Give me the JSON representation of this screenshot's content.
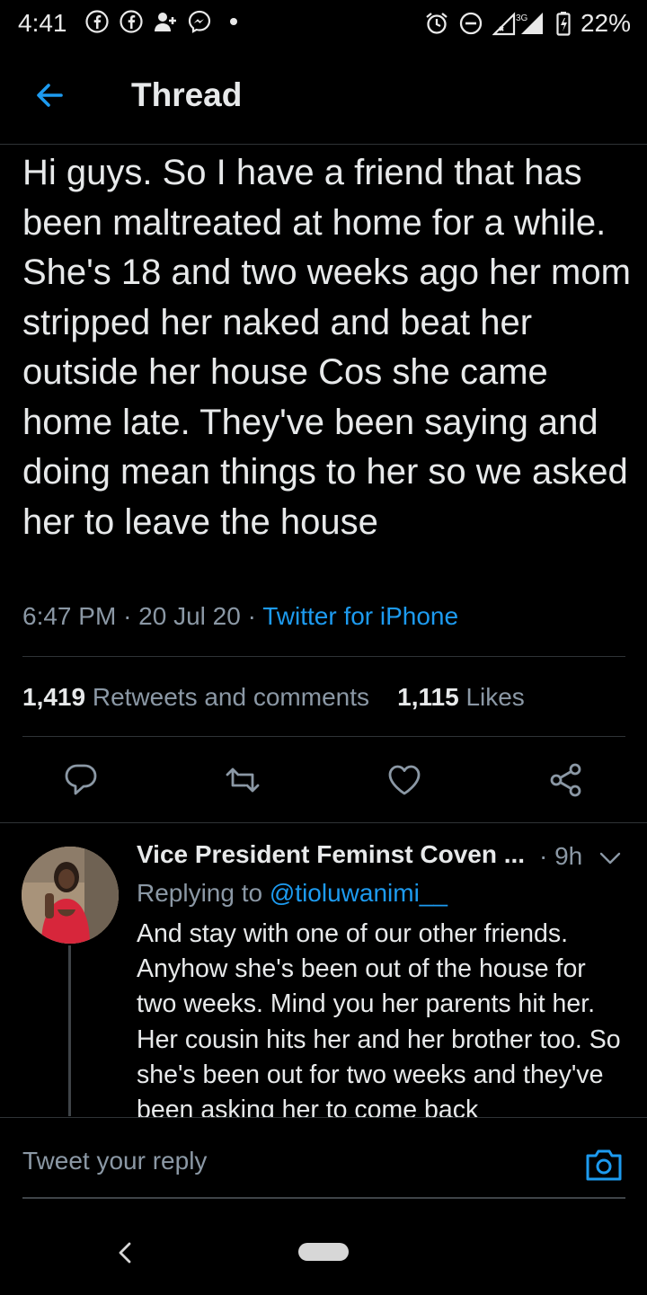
{
  "status_bar": {
    "time": "4:41",
    "battery": "22%",
    "network": "3G",
    "left_icons": [
      "facebook-icon",
      "facebook-icon",
      "add-friend-icon",
      "messenger-icon",
      "dot-icon"
    ],
    "right_icons": [
      "alarm-icon",
      "dnd-icon",
      "signal-icon",
      "battery-icon"
    ]
  },
  "header": {
    "title": "Thread"
  },
  "tweet": {
    "text": "Hi guys. So I have a friend that has been maltreated at home for a while. She's 18 and two weeks ago her mom stripped her naked and beat her outside her house Cos she came home late. They've been saying and doing mean things to her so we asked her to leave the house",
    "time": "6:47 PM",
    "date": "20 Jul 20",
    "source": "Twitter for iPhone",
    "retweets_count": "1,419",
    "retweets_label": "Retweets and comments",
    "likes_count": "1,115",
    "likes_label": "Likes"
  },
  "reply": {
    "author": "Vice President Feminst Coven ...",
    "age": "9h",
    "replying_prefix": "Replying to",
    "replying_handle": "@tioluwanimi__",
    "text": "And stay with one of our other friends. Anyhow she's been out of the house for two weeks. Mind you her parents hit her. Her cousin hits her and her brother too. So she's been out for two weeks and they've been asking her to come back"
  },
  "composer": {
    "placeholder": "Tweet your reply"
  },
  "colors": {
    "background": "#000000",
    "accent": "#1d9bf0",
    "muted": "#8b98a5",
    "text": "#e7e9ea"
  }
}
